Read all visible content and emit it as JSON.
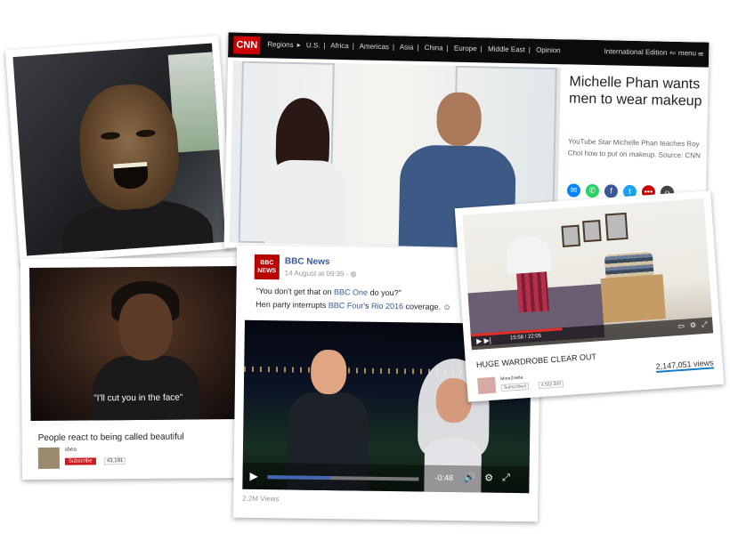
{
  "cnn": {
    "logo": "CNN",
    "nav": [
      "Regions",
      "U.S.",
      "Africa",
      "Americas",
      "Asia",
      "China",
      "Europe",
      "Middle East",
      "Opinion"
    ],
    "edition": "International Edition +",
    "menu": "menu",
    "headline": "Michelle Phan wants men to wear makeup",
    "description": "YouTube Star Michelle Phan teaches Roy Choi how to put on makeup. Source: CNN",
    "share_colors": {
      "messenger": "#0084ff",
      "whatsapp": "#25d366",
      "facebook": "#3b5998",
      "twitter": "#1da1f2",
      "more": "#cc0000",
      "embed": "#444444"
    }
  },
  "beauty": {
    "subtitle": "\"I'll cut you in the face\"",
    "title": "People react to being called beautiful",
    "channel": "shea",
    "subscribe": "Subscribe",
    "subscribers": "43,191"
  },
  "bbc": {
    "logo": "BBC NEWS",
    "name": "BBC News",
    "date": "14 August at 09:35 · ",
    "quote_pre": "\"You don't get that on ",
    "quote_link": "BBC One",
    "quote_post": " do you?\"",
    "line2_pre": "Hen party interrupts ",
    "line2_link1": "BBC Four",
    "line2_mid": "'s ",
    "line2_link2": "Rio 2016",
    "line2_post": " coverage.",
    "time": "-0:48",
    "progress": 0.42,
    "views": "2.2M Views"
  },
  "wardrobe": {
    "time": "15:58 / 22:05",
    "title": "HUGE WARDROBE CLEAR OUT",
    "channel": "MoreZoella",
    "subscribed": "Subscribed",
    "subscribers": "4,502,500",
    "views": "2,147,051 views",
    "progress": 0.38
  }
}
